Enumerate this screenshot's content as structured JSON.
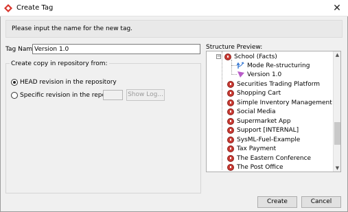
{
  "window": {
    "title": "Create Tag",
    "close_glyph": "✕"
  },
  "info": {
    "message": "Please input the name for the new tag."
  },
  "tag_name": {
    "label": "Tag Name:",
    "value": "Version 1.0"
  },
  "copy_group": {
    "title": "Create copy in repository from:",
    "options": [
      {
        "label": "HEAD revision in the repository",
        "selected": true
      },
      {
        "label": "Specific revision in the repository",
        "selected": false
      }
    ],
    "revision_value": "",
    "show_log_label": "Show Log..."
  },
  "structure_preview": {
    "label": "Structure Preview:",
    "items": [
      {
        "label": "School (Facts)",
        "icon": "project-icon",
        "expanded": true
      },
      {
        "label": "Mode Re-structuring",
        "icon": "branch-icon"
      },
      {
        "label": "Version 1.0",
        "icon": "tag-flag-icon"
      },
      {
        "label": "Securities Trading Platform",
        "icon": "project-icon"
      },
      {
        "label": "Shopping Cart",
        "icon": "project-icon"
      },
      {
        "label": "Simple Inventory Management",
        "icon": "project-icon"
      },
      {
        "label": "Social Media",
        "icon": "project-icon"
      },
      {
        "label": "Supermarket App",
        "icon": "project-icon"
      },
      {
        "label": "Support [INTERNAL]",
        "icon": "project-icon"
      },
      {
        "label": "SysML-Fuel-Example",
        "icon": "project-icon"
      },
      {
        "label": "Tax Payment",
        "icon": "project-icon"
      },
      {
        "label": "The Eastern Conference",
        "icon": "project-icon"
      },
      {
        "label": "The Post Office",
        "icon": "project-icon"
      }
    ]
  },
  "buttons": {
    "create": "Create",
    "cancel": "Cancel"
  },
  "colors": {
    "project_icon": "#c93b34",
    "tag_icon": "#b85cc8",
    "branch_icon": "#3a7bd5"
  }
}
